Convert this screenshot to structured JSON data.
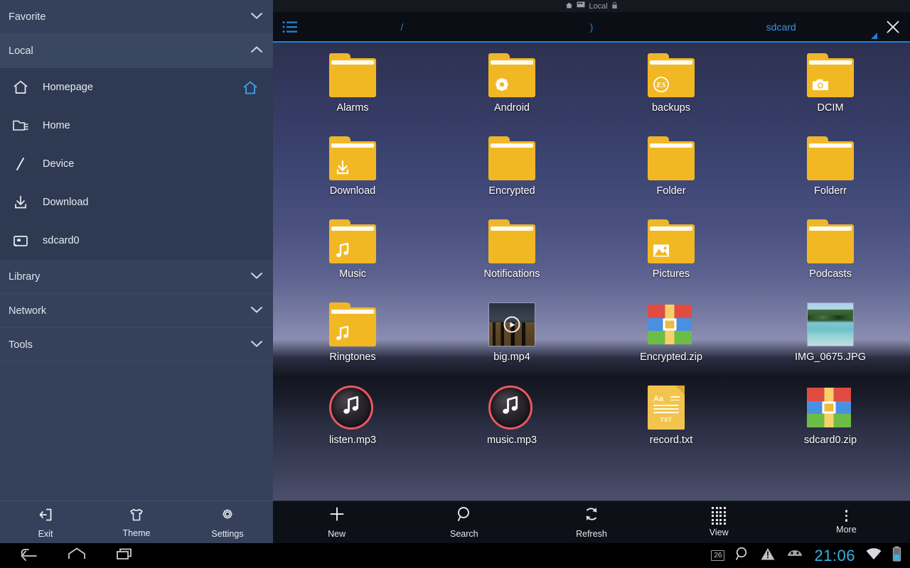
{
  "sidebar": {
    "groups": [
      {
        "label": "Favorite",
        "state": "collapsed"
      },
      {
        "label": "Local",
        "state": "expanded"
      }
    ],
    "local_items": [
      {
        "label": "Homepage",
        "icon": "home-outline-icon",
        "trailing_icon": "home-accent-icon"
      },
      {
        "label": "Home",
        "icon": "folder-list-icon",
        "trailing_icon": ""
      },
      {
        "label": "Device",
        "icon": "slash-root-icon",
        "trailing_icon": ""
      },
      {
        "label": "Download",
        "icon": "download-icon",
        "trailing_icon": ""
      },
      {
        "label": "sdcard0",
        "icon": "sdcard-icon",
        "trailing_icon": ""
      }
    ],
    "lower_groups": [
      {
        "label": "Library",
        "state": "collapsed"
      },
      {
        "label": "Network",
        "state": "collapsed"
      },
      {
        "label": "Tools",
        "state": "collapsed"
      }
    ],
    "bottom_buttons": [
      {
        "label": "Exit",
        "icon": "exit-icon"
      },
      {
        "label": "Theme",
        "icon": "tshirt-icon"
      },
      {
        "label": "Settings",
        "icon": "gear-icon"
      }
    ]
  },
  "window": {
    "status_label": "Local",
    "status_icons": [
      "home-icon",
      "device-icon",
      "lock-icon"
    ]
  },
  "tabbar": {
    "menu_icon": "list-menu-icon",
    "close_icon": "close-icon",
    "tabs": [
      {
        "label": "/",
        "active": false
      },
      {
        "label": ")",
        "active": false
      },
      {
        "label": "sdcard",
        "active": true
      }
    ]
  },
  "files": [
    {
      "name": "Alarms",
      "type": "folder",
      "badge": ""
    },
    {
      "name": "Android",
      "type": "folder",
      "badge": "android-gear-icon"
    },
    {
      "name": "backups",
      "type": "folder",
      "badge": "es-logo-icon"
    },
    {
      "name": "DCIM",
      "type": "folder",
      "badge": "camera-icon"
    },
    {
      "name": "Download",
      "type": "folder",
      "badge": "download-icon"
    },
    {
      "name": "Encrypted",
      "type": "folder",
      "badge": ""
    },
    {
      "name": "Folder",
      "type": "folder",
      "badge": ""
    },
    {
      "name": "Folderr",
      "type": "folder",
      "badge": ""
    },
    {
      "name": "Music",
      "type": "folder",
      "badge": "music-note-icon"
    },
    {
      "name": "Notifications",
      "type": "folder",
      "badge": ""
    },
    {
      "name": "Pictures",
      "type": "folder",
      "badge": "picture-icon"
    },
    {
      "name": "Podcasts",
      "type": "folder",
      "badge": ""
    },
    {
      "name": "Ringtones",
      "type": "folder",
      "badge": "music-note-icon"
    },
    {
      "name": "big.mp4",
      "type": "video",
      "badge": "play-icon"
    },
    {
      "name": "Encrypted.zip",
      "type": "zip",
      "badge": ""
    },
    {
      "name": "IMG_0675.JPG",
      "type": "image",
      "badge": ""
    },
    {
      "name": "listen.mp3",
      "type": "audio",
      "badge": "music-note-icon"
    },
    {
      "name": "music.mp3",
      "type": "audio",
      "badge": "music-note-icon"
    },
    {
      "name": "record.txt",
      "type": "text",
      "badge": "TXT"
    },
    {
      "name": "sdcard0.zip",
      "type": "zip",
      "badge": ""
    }
  ],
  "toolbar": {
    "buttons": [
      {
        "label": "New",
        "icon": "plus-icon"
      },
      {
        "label": "Search",
        "icon": "search-icon"
      },
      {
        "label": "Refresh",
        "icon": "refresh-icon"
      },
      {
        "label": "View",
        "icon": "grid-view-icon"
      },
      {
        "label": "More",
        "icon": "overflow-dots-icon"
      }
    ]
  },
  "system_bar": {
    "nav_icons": [
      "back-icon",
      "home-icon",
      "recents-icon"
    ],
    "notification_count": "26",
    "status_icons": [
      "search-icon",
      "warning-icon",
      "android-head-icon",
      "wifi-icon",
      "battery-icon"
    ],
    "clock": "21:06"
  },
  "colors": {
    "sidebar_bg": "#35415a",
    "sidebar_item_bg": "#2e3a51",
    "accent_blue": "#1f82d8",
    "clock_blue": "#33b5e5",
    "folder_yellow": "#f2b824",
    "mp3_ring": "#e8575f"
  }
}
